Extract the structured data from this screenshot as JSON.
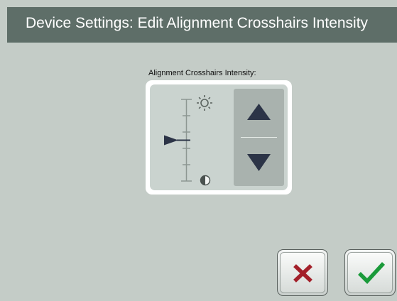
{
  "header": {
    "title": "Device Settings: Edit Alignment Crosshairs Intensity"
  },
  "intensity": {
    "label": "Alignment Crosshairs Intensity:",
    "level": 0.5,
    "max_icon": "sun-icon",
    "min_icon": "contrast-icon"
  },
  "stepper": {
    "up_icon": "triangle-up-icon",
    "down_icon": "triangle-down-icon"
  },
  "actions": {
    "cancel_icon": "x-icon",
    "confirm_icon": "check-icon"
  },
  "colors": {
    "title_bar": "#5e6e68",
    "background": "#c4ccc7",
    "arrow": "#2c3447",
    "cancel": "#a3202a",
    "confirm": "#1a9a3a"
  }
}
